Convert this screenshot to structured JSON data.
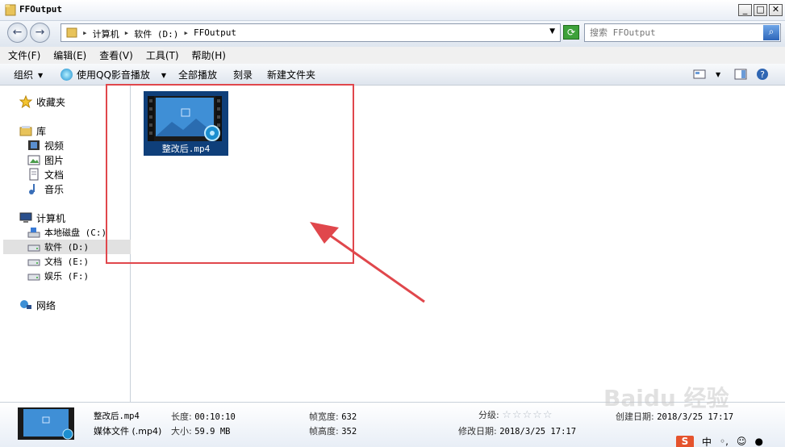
{
  "window": {
    "title": "FFOutput"
  },
  "address": {
    "crumbs": [
      "计算机",
      "软件 (D:)",
      "FFOutput"
    ]
  },
  "search": {
    "placeholder": "搜索 FFOutput"
  },
  "menu": [
    "文件(F)",
    "编辑(E)",
    "查看(V)",
    "工具(T)",
    "帮助(H)"
  ],
  "commands": {
    "organize": "组织",
    "play_with": "使用QQ影音播放",
    "play_all": "全部播放",
    "burn": "刻录",
    "new_folder": "新建文件夹"
  },
  "nav": {
    "favorites": "收藏夹",
    "library": "库",
    "library_items": [
      "视频",
      "图片",
      "文档",
      "音乐"
    ],
    "computer": "计算机",
    "drives": [
      "本地磁盘 (C:)",
      "软件 (D:)",
      "文档 (E:)",
      "娱乐 (F:)"
    ],
    "network": "网络"
  },
  "file": {
    "name": "整改后.mp4"
  },
  "details": {
    "name": "整改后.mp4",
    "type": "媒体文件 (.mp4)",
    "length_label": "长度:",
    "length": "00:10:10",
    "size_label": "大小:",
    "size": "59.9 MB",
    "width_label": "帧宽度:",
    "width": "632",
    "height_label": "帧高度:",
    "height": "352",
    "rating_label": "分级:",
    "rating": 0,
    "created_label": "创建日期:",
    "created": "2018/3/25 17:17",
    "modified_label": "修改日期:",
    "modified": "2018/3/25 17:17"
  },
  "watermark": "Baidu 经验",
  "ime": {
    "lang": "中"
  },
  "colors": {
    "annotation": "#e0474c",
    "selection": "#0f3f7a"
  }
}
